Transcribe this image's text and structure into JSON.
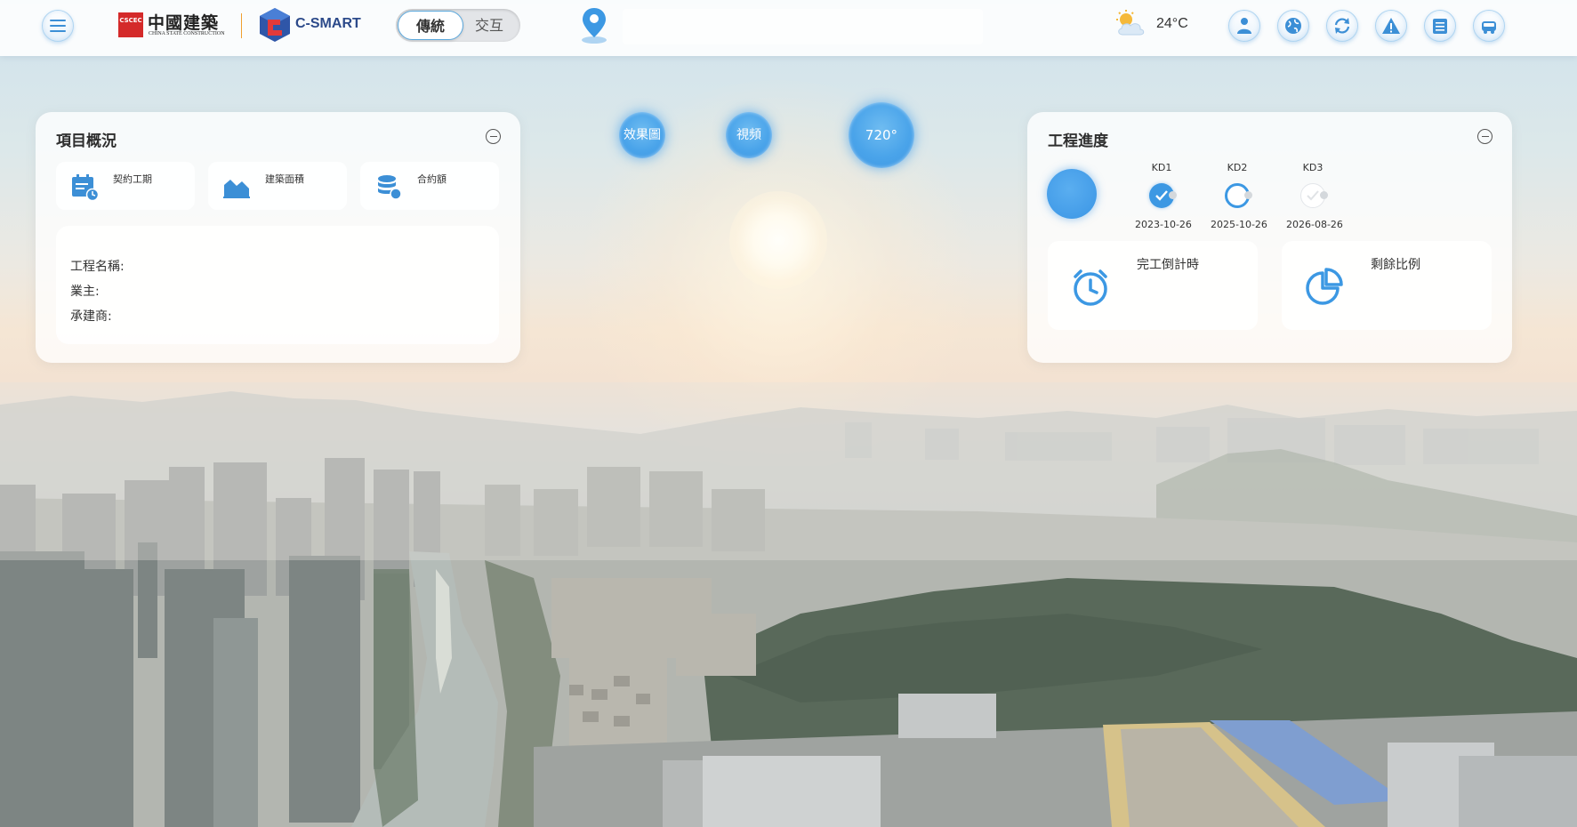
{
  "header": {
    "logo_mark": "CSCEC",
    "logo_cn": "中國建築",
    "logo_en": "CHINA STATE CONSTRUCTION",
    "brand": "C-SMART",
    "mode_toggle": {
      "active": "傳統",
      "inactive": "交互"
    },
    "weather": {
      "icon": "partly-cloudy-icon",
      "temperature": "24°C"
    },
    "tools": [
      "person-icon",
      "globe-icon",
      "sync-icon",
      "warning-icon",
      "archive-icon",
      "car-icon"
    ]
  },
  "media_buttons": {
    "effect": "效果圖",
    "video": "視頻",
    "panorama": "720°"
  },
  "project_overview": {
    "title": "項目概況",
    "stats": [
      {
        "label": "契約工期",
        "icon": "calendar-clock-icon"
      },
      {
        "label": "建築面積",
        "icon": "area-chart-icon"
      },
      {
        "label": "合約額",
        "icon": "coins-icon"
      }
    ],
    "details": {
      "name_label": "工程名稱:",
      "owner_label": "業主:",
      "contractor_label": "承建商:"
    }
  },
  "engineering_progress": {
    "title": "工程進度",
    "milestones": [
      {
        "name": "KD1",
        "date": "2023-10-26",
        "state": "done"
      },
      {
        "name": "KD2",
        "date": "2025-10-26",
        "state": "current"
      },
      {
        "name": "KD3",
        "date": "2026-08-26",
        "state": "future"
      }
    ],
    "cards": [
      {
        "label": "完工倒計時",
        "icon": "alarm-clock-icon"
      },
      {
        "label": "剩餘比例",
        "icon": "pie-chart-icon"
      }
    ]
  },
  "colors": {
    "accent": "#3c98e3",
    "brand_red": "#d42a2a",
    "brand_navy": "#2c4a8a"
  }
}
